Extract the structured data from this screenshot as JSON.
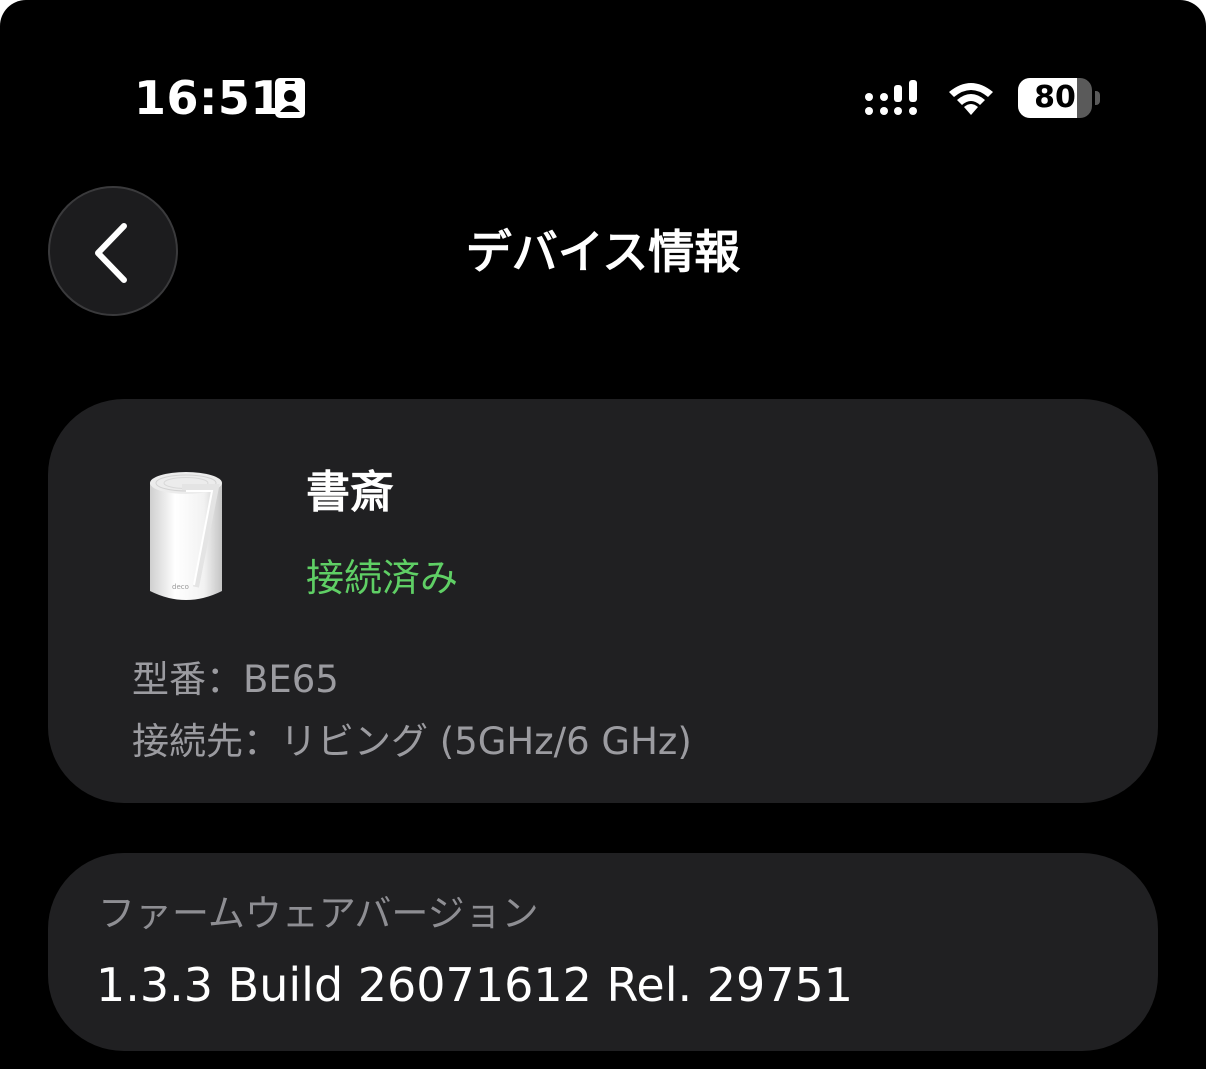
{
  "status_bar": {
    "time": "16:51",
    "battery_level": "80",
    "battery_fraction": 0.8,
    "icons": [
      "contact-card-icon",
      "cellular-signal-icon",
      "wifi-icon",
      "battery-icon"
    ]
  },
  "header": {
    "title": "デバイス情報",
    "back_icon": "chevron-left-icon"
  },
  "device": {
    "image_label": "deco",
    "name": "書斎",
    "status": "接続済み",
    "status_color": "#5fcf65",
    "model_line": "型番：BE65",
    "connection_line": "接続先：リビング (5GHz/6 GHz)"
  },
  "firmware": {
    "label": "ファームウェアバージョン",
    "value": "1.3.3 Build 26071612 Rel. 29751"
  }
}
